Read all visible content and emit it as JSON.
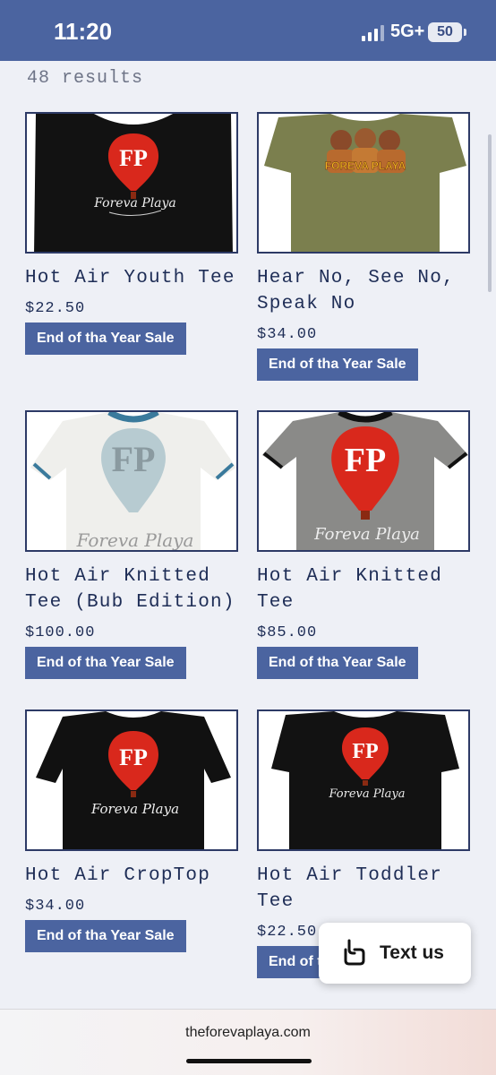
{
  "status_bar": {
    "time": "11:20",
    "network": "5G+",
    "battery": "50"
  },
  "results_label": "48 results",
  "products": [
    {
      "name": "Hot Air Youth Tee",
      "price": "$22.50",
      "badge": "End of tha Year Sale"
    },
    {
      "name": "Hear No, See No, Speak No",
      "price": "$34.00",
      "badge": "End of tha Year Sale",
      "print_text": "FOREVA PLAYA"
    },
    {
      "name": "Hot Air Knitted Tee (Bub Edition)",
      "price": "$100.00",
      "badge": "End of tha Year Sale"
    },
    {
      "name": "Hot Air Knitted Tee",
      "price": "$85.00",
      "badge": "End of tha Year Sale"
    },
    {
      "name": "Hot Air CropTop",
      "price": "$34.00",
      "badge": "End of tha Year Sale"
    },
    {
      "name": "Hot Air Toddler Tee",
      "price": "$22.50",
      "badge": "End of tha Year Sale"
    }
  ],
  "logo": {
    "mark": "FP",
    "script": "Foreva Playa"
  },
  "chat": {
    "label": "Text us"
  },
  "browser": {
    "url": "theforevaplaya.com"
  },
  "colors": {
    "accent": "#4b64a0",
    "text": "#1e2d56",
    "balloon": "#d9281c"
  }
}
